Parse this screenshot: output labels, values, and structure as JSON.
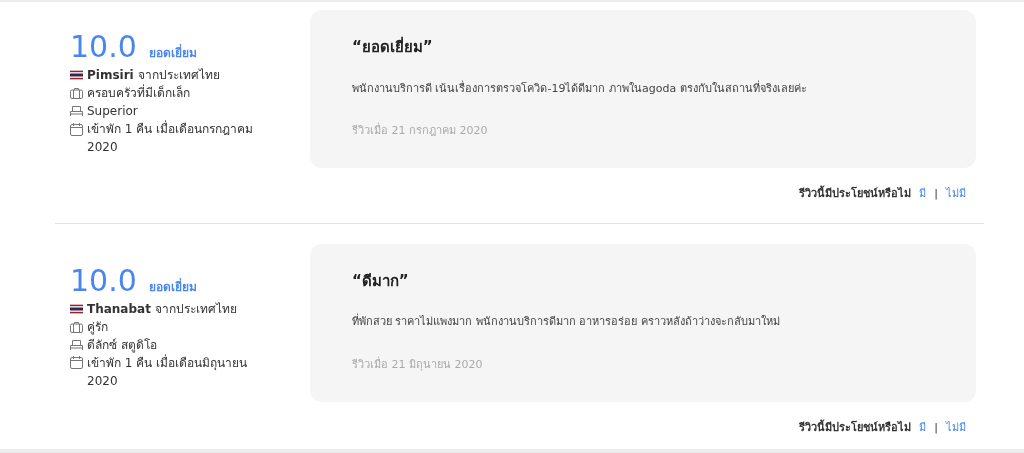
{
  "reviews": [
    {
      "score": "10.0",
      "score_label": "ยอดเยี่ยม",
      "reviewer": "Pimsiri",
      "country": "จากประเทศไทย",
      "traveler_type": "ครอบครัวที่มีเด็กเล็ก",
      "room": "Superior",
      "stay": "เข้าพัก 1 คืน เมื่อเดือนกรกฎาคม 2020",
      "title": "“ยอดเยี่ยม”",
      "body": "พนักงานบริการดี เน้นเรื่องการตรวจโควิด-19ได้ดีมาก ภาพในagoda ตรงกับในสถานที่จริงเลยค่ะ",
      "date": "รีวิวเมื่อ 21 กรกฎาคม 2020",
      "helpful_prompt": "รีวิวนี้มีประโยชน์หรือไม่",
      "yes": "มี",
      "separator": "|",
      "no": "ไม่มี"
    },
    {
      "score": "10.0",
      "score_label": "ยอดเยี่ยม",
      "reviewer": "Thanabat",
      "country": "จากประเทศไทย",
      "traveler_type": "คู่รัก",
      "room": "ดีลักซ์ สตูดิโอ",
      "stay": "เข้าพัก 1 คืน เมื่อเดือนมิถุนายน 2020",
      "title": "“ดีมาก”",
      "body": "ที่พักสวย ราคาไม่แพงมาก พนักงานบริการดีมาก อาหารอร่อย คราวหลังถ้าว่างจะกลับมาใหม่",
      "date": "รีวิวเมื่อ 21 มิถุนายน 2020",
      "helpful_prompt": "รีวิวนี้มีประโยชน์หรือไม่",
      "yes": "มี",
      "separator": "|",
      "no": "ไม่มี"
    }
  ]
}
